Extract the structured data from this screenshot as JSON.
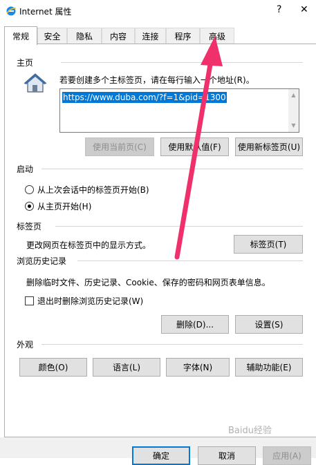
{
  "window": {
    "title": "Internet 属性",
    "help_glyph": "?",
    "close_glyph": "✕"
  },
  "tabs": [
    {
      "label": "常规",
      "active": true
    },
    {
      "label": "安全"
    },
    {
      "label": "隐私"
    },
    {
      "label": "内容"
    },
    {
      "label": "连接"
    },
    {
      "label": "程序"
    },
    {
      "label": "高级"
    }
  ],
  "home": {
    "group_label": "主页",
    "description": "若要创建多个主标签页，请在每行输入一个地址(R)。",
    "url": "https://www.duba.com/?f=1&pid=1300",
    "use_current_label": "使用当前页(C)",
    "use_default_label": "使用默认值(F)",
    "use_new_tab_label": "使用新标签页(U)"
  },
  "startup": {
    "group_label": "启动",
    "option_last_session": "从上次会话中的标签页开始(B)",
    "option_home_page": "从主页开始(H)"
  },
  "tabs_section": {
    "group_label": "标签页",
    "description": "更改网页在标签页中的显示方式。",
    "button_label": "标签页(T)"
  },
  "history": {
    "group_label": "浏览历史记录",
    "description": "删除临时文件、历史记录、Cookie、保存的密码和网页表单信息。",
    "checkbox_label": "退出时删除浏览历史记录(W)",
    "delete_label": "删除(D)...",
    "settings_label": "设置(S)"
  },
  "appearance": {
    "group_label": "外观",
    "colors_label": "颜色(O)",
    "languages_label": "语言(L)",
    "fonts_label": "字体(N)",
    "accessibility_label": "辅助功能(E)"
  },
  "footer": {
    "ok_label": "确定",
    "cancel_label": "取消",
    "apply_label": "应用(A)"
  },
  "watermark": "Baidu经验",
  "colors": {
    "selection": "#0078d7",
    "annotation_arrow": "#f0306a",
    "button_face": "#e1e1e1",
    "disabled_text": "#8d8d8d"
  }
}
